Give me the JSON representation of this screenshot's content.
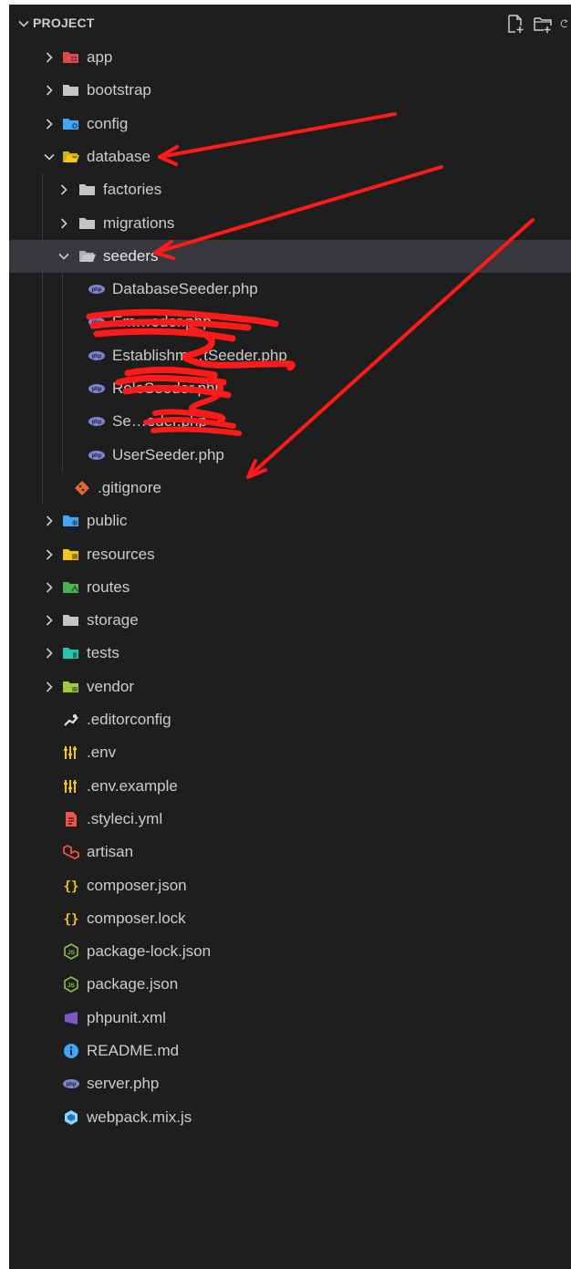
{
  "explorer": {
    "section_title": "PROJECT",
    "actions": [
      {
        "name": "new-file-icon"
      },
      {
        "name": "new-folder-icon"
      },
      {
        "name": "refresh-icon"
      }
    ]
  },
  "tree": [
    {
      "label": "app",
      "type": "folder",
      "depth": 0,
      "expanded": false,
      "icon": "app-folder-icon",
      "color": "#e04a4a"
    },
    {
      "label": "bootstrap",
      "type": "folder",
      "depth": 0,
      "expanded": false,
      "icon": "folder-icon",
      "color": "#c5c5c5"
    },
    {
      "label": "config",
      "type": "folder",
      "depth": 0,
      "expanded": false,
      "icon": "config-folder-icon",
      "color": "#42a5f5"
    },
    {
      "label": "database",
      "type": "folder",
      "depth": 0,
      "expanded": true,
      "icon": "database-folder-open-icon",
      "color": "#f5c518"
    },
    {
      "label": "factories",
      "type": "folder",
      "depth": 1,
      "expanded": false,
      "icon": "folder-icon",
      "color": "#c5c5c5"
    },
    {
      "label": "migrations",
      "type": "folder",
      "depth": 1,
      "expanded": false,
      "icon": "folder-icon",
      "color": "#c5c5c5"
    },
    {
      "label": "seeders",
      "type": "folder",
      "depth": 1,
      "expanded": true,
      "selected": true,
      "icon": "folder-open-icon",
      "color": "#c5c5c5"
    },
    {
      "label": "DatabaseSeeder.php",
      "type": "file",
      "depth": 2,
      "icon": "php-file-icon",
      "color": "#7a86d4"
    },
    {
      "label": "Em…eder.php",
      "type": "file",
      "depth": 2,
      "icon": "php-file-icon",
      "color": "#7a86d4"
    },
    {
      "label": "Establishm…tSeeder.php",
      "type": "file",
      "depth": 2,
      "icon": "php-file-icon",
      "color": "#7a86d4"
    },
    {
      "label": "RoleSeeder.php",
      "type": "file",
      "depth": 2,
      "icon": "php-file-icon",
      "color": "#7a86d4"
    },
    {
      "label": "Se…eder.php",
      "type": "file",
      "depth": 2,
      "icon": "php-file-icon",
      "color": "#7a86d4"
    },
    {
      "label": "UserSeeder.php",
      "type": "file",
      "depth": 2,
      "icon": "php-file-icon",
      "color": "#7a86d4"
    },
    {
      "label": ".gitignore",
      "type": "file",
      "depth": 1,
      "icon": "git-icon",
      "color": "#e8672b"
    },
    {
      "label": "public",
      "type": "folder",
      "depth": 0,
      "expanded": false,
      "icon": "public-folder-icon",
      "color": "#42a5f5"
    },
    {
      "label": "resources",
      "type": "folder",
      "depth": 0,
      "expanded": false,
      "icon": "resources-folder-icon",
      "color": "#f5c518"
    },
    {
      "label": "routes",
      "type": "folder",
      "depth": 0,
      "expanded": false,
      "icon": "routes-folder-icon",
      "color": "#4caf50"
    },
    {
      "label": "storage",
      "type": "folder",
      "depth": 0,
      "expanded": false,
      "icon": "folder-icon",
      "color": "#c5c5c5"
    },
    {
      "label": "tests",
      "type": "folder",
      "depth": 0,
      "expanded": false,
      "icon": "tests-folder-icon",
      "color": "#26c6b0"
    },
    {
      "label": "vendor",
      "type": "folder",
      "depth": 0,
      "expanded": false,
      "icon": "vendor-folder-icon",
      "color": "#9ccc3a"
    },
    {
      "label": ".editorconfig",
      "type": "file",
      "depth": 0,
      "icon": "editorconfig-icon",
      "color": "#e0e0e0"
    },
    {
      "label": ".env",
      "type": "file",
      "depth": 0,
      "icon": "env-icon",
      "color": "#f5c518"
    },
    {
      "label": ".env.example",
      "type": "file",
      "depth": 0,
      "icon": "env-icon",
      "color": "#f5c518"
    },
    {
      "label": ".styleci.yml",
      "type": "file",
      "depth": 0,
      "icon": "yaml-file-icon",
      "color": "#ef5350"
    },
    {
      "label": "artisan",
      "type": "file",
      "depth": 0,
      "icon": "laravel-icon",
      "color": "#f05340"
    },
    {
      "label": "composer.json",
      "type": "file",
      "depth": 0,
      "icon": "json-icon",
      "color": "#f5c518"
    },
    {
      "label": "composer.lock",
      "type": "file",
      "depth": 0,
      "icon": "json-icon",
      "color": "#f5c518"
    },
    {
      "label": "package-lock.json",
      "type": "file",
      "depth": 0,
      "icon": "nodejs-icon",
      "color": "#8bc34a"
    },
    {
      "label": "package.json",
      "type": "file",
      "depth": 0,
      "icon": "nodejs-icon",
      "color": "#8bc34a"
    },
    {
      "label": "phpunit.xml",
      "type": "file",
      "depth": 0,
      "icon": "phpunit-icon",
      "color": "#7e57c2"
    },
    {
      "label": "README.md",
      "type": "file",
      "depth": 0,
      "icon": "info-icon",
      "color": "#42a5f5"
    },
    {
      "label": "server.php",
      "type": "file",
      "depth": 0,
      "icon": "php-file-icon",
      "color": "#7a86d4"
    },
    {
      "label": "webpack.mix.js",
      "type": "file",
      "depth": 0,
      "icon": "webpack-icon",
      "color": "#8ed6fb"
    }
  ],
  "annotation": {
    "arrow_color": "#ff1a1a",
    "redaction_color": "#ff1a1a"
  }
}
